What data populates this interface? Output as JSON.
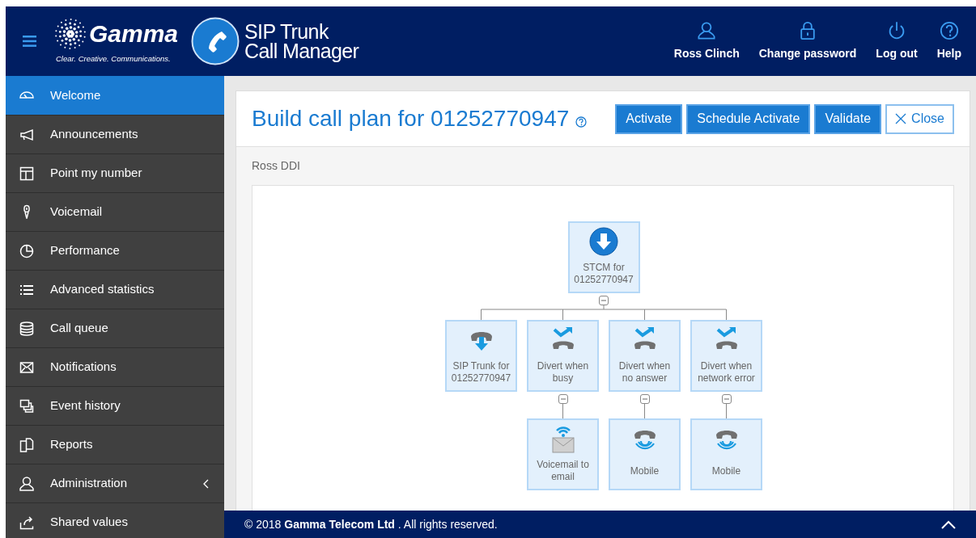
{
  "header": {
    "logo_name": "Gamma",
    "logo_tagline": "Clear. Creative. Communications.",
    "app_title": [
      "SIP Trunk",
      "Call Manager"
    ],
    "actions": [
      {
        "kind": "user",
        "label": "Ross Clinch"
      },
      {
        "kind": "lock",
        "label": "Change password"
      },
      {
        "kind": "power",
        "label": "Log out"
      },
      {
        "kind": "help",
        "label": "Help"
      }
    ]
  },
  "sidebar": {
    "items": [
      {
        "kind": "dashboard",
        "label": "Welcome",
        "selected": true
      },
      {
        "kind": "megaphone",
        "label": "Announcements",
        "selected": false
      },
      {
        "kind": "layout",
        "label": "Point my number",
        "selected": false
      },
      {
        "kind": "mic",
        "label": "Voicemail",
        "selected": false
      },
      {
        "kind": "pie",
        "label": "Performance",
        "selected": false
      },
      {
        "kind": "list",
        "label": "Advanced statistics",
        "selected": false
      },
      {
        "kind": "database",
        "label": "Call queue",
        "selected": false
      },
      {
        "kind": "envelope",
        "label": "Notifications",
        "selected": false
      },
      {
        "kind": "windows",
        "label": "Event history",
        "selected": false
      },
      {
        "kind": "copy",
        "label": "Reports",
        "selected": false
      },
      {
        "kind": "user",
        "label": "Administration",
        "selected": false,
        "expandable": true
      },
      {
        "kind": "share",
        "label": "Shared values",
        "selected": false
      }
    ]
  },
  "card": {
    "title": "Build call plan for 01252770947",
    "buttons": [
      {
        "kind": "primary",
        "label": "Activate"
      },
      {
        "kind": "primary",
        "label": "Schedule Activate"
      },
      {
        "kind": "primary",
        "label": "Validate"
      },
      {
        "kind": "close",
        "label": "Close"
      }
    ],
    "subtitle": "Ross DDI",
    "call_plan": {
      "kind": "incoming",
      "label": "STCM for 01252770947",
      "expanded": true,
      "children": [
        {
          "kind": "sip-trunk",
          "label": "SIP Trunk for 01252770947"
        },
        {
          "kind": "divert",
          "label": "Divert when busy",
          "expanded": true,
          "children": [
            {
              "kind": "voicemail",
              "label": "Voicemail to email"
            }
          ]
        },
        {
          "kind": "divert",
          "label": "Divert when no answer",
          "expanded": true,
          "children": [
            {
              "kind": "mobile",
              "label": "Mobile"
            }
          ]
        },
        {
          "kind": "divert",
          "label": "Divert when network error",
          "expanded": true,
          "children": [
            {
              "kind": "mobile",
              "label": "Mobile"
            }
          ]
        }
      ]
    }
  },
  "footer": {
    "text": "© 2018 **Gamma Telecom Ltd** . All rights reserved."
  }
}
